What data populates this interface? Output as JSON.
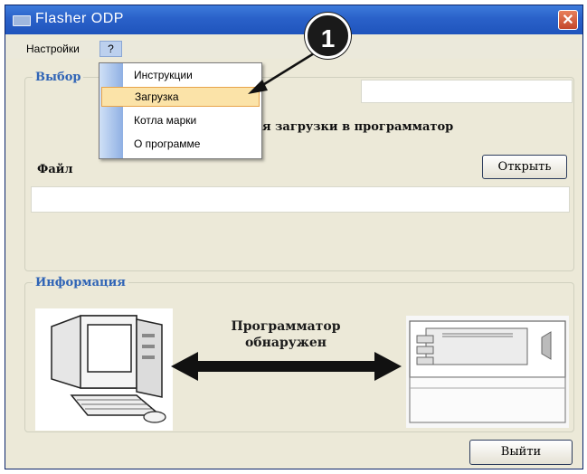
{
  "window": {
    "title": "Flasher ODP",
    "close_glyph": "✕"
  },
  "menubar": {
    "items": [
      {
        "label": "Настройки"
      },
      {
        "label": "?"
      }
    ]
  },
  "dropdown": {
    "items": [
      {
        "label": "Инструкции"
      },
      {
        "label": "Загрузка",
        "highlighted": true
      },
      {
        "label": "Котла марки"
      },
      {
        "label": "О программе"
      }
    ]
  },
  "select_group": {
    "title": "Выбор",
    "visible_caption": "я загрузки в программатор",
    "file_label": "Файл",
    "open_button": "Открыть",
    "file_path_value": "",
    "top_field_value": ""
  },
  "info_group": {
    "title": "Информация",
    "status_line1": "Программатор",
    "status_line2": "обнаружен"
  },
  "exit_button": "Выйти",
  "callout": {
    "number": "1"
  },
  "colors": {
    "titlebar": "#2a61c9",
    "window_bg": "#ece9d8",
    "group_title": "#2f64b6",
    "highlight_bg": "#fbe3a8",
    "close_button": "#d5573a"
  },
  "icons": [
    "app-window-icon",
    "close-icon",
    "computer-illustration",
    "programmer-device-illustration",
    "double-arrow-icon"
  ]
}
